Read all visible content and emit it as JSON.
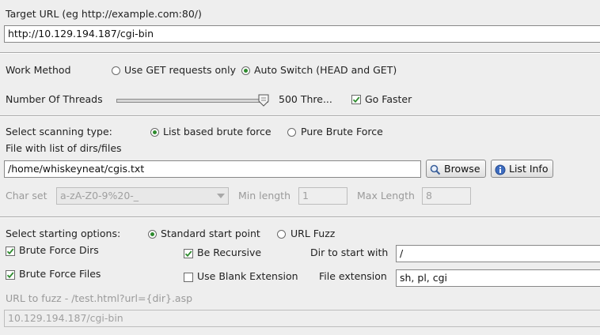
{
  "target": {
    "label": "Target URL (eg http://example.com:80/)",
    "value": "http://10.129.194.187/cgi-bin"
  },
  "work_method": {
    "label": "Work Method",
    "options": [
      "Use GET requests only",
      "Auto Switch (HEAD and GET)"
    ],
    "selected": "Auto Switch (HEAD and GET)"
  },
  "threads": {
    "label": "Number Of Threads",
    "value_text": "500 Thre...",
    "slider_fraction": 0.99,
    "go_faster_label": "Go Faster",
    "go_faster_checked": true
  },
  "scanning": {
    "label": "Select scanning type:",
    "options": [
      "List based brute force",
      "Pure Brute Force"
    ],
    "selected": "List based brute force",
    "file_label": "File with list of dirs/files",
    "file_value": "/home/whiskeyneat/cgis.txt",
    "browse_label": "Browse",
    "list_info_label": "List Info"
  },
  "charset": {
    "label": "Char set",
    "value": "a-zA-Z0-9%20-_",
    "min_label": "Min length",
    "min_value": "1",
    "max_label": "Max Length",
    "max_value": "8"
  },
  "start": {
    "label": "Select starting options:",
    "options": [
      "Standard start point",
      "URL Fuzz"
    ],
    "selected": "Standard start point",
    "brute_dirs_label": "Brute Force Dirs",
    "brute_dirs_checked": true,
    "brute_files_label": "Brute Force Files",
    "brute_files_checked": true,
    "recursive_label": "Be Recursive",
    "recursive_checked": true,
    "blank_ext_label": "Use Blank Extension",
    "blank_ext_checked": false,
    "dir_start_label": "Dir to start with",
    "dir_start_value": "/",
    "file_ext_label": "File extension",
    "file_ext_value": "sh, pl, cgi"
  },
  "fuzz": {
    "label": "URL to fuzz - /test.html?url={dir}.asp",
    "value": "10.129.194.187/cgi-bin"
  }
}
